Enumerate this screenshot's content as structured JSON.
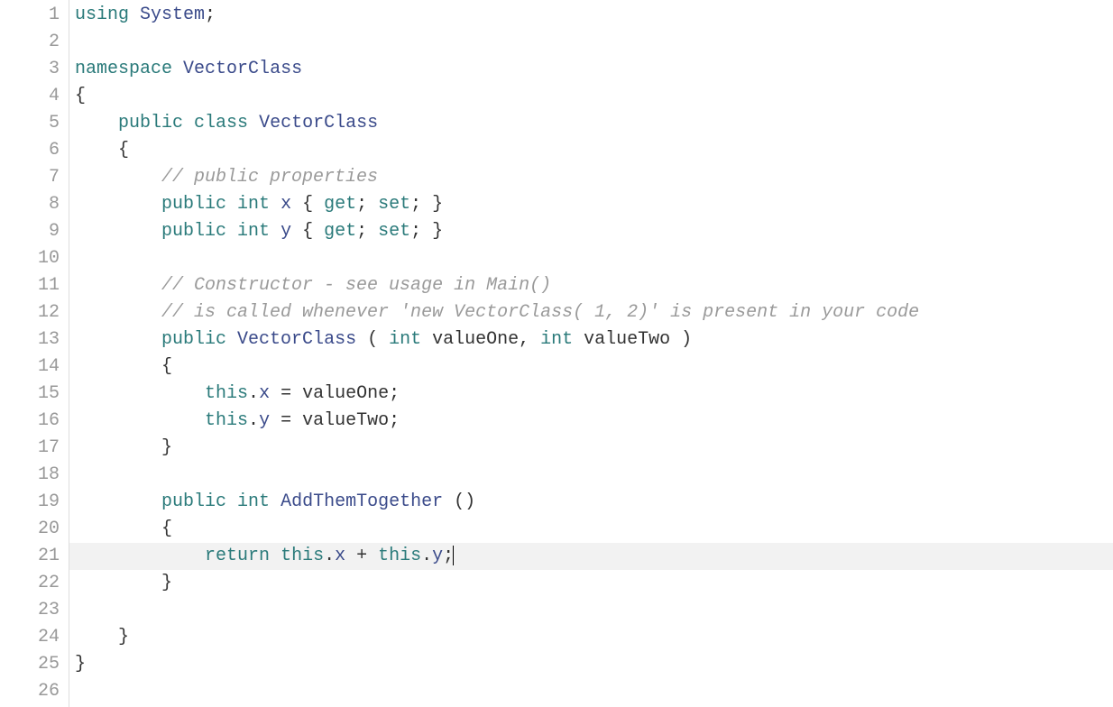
{
  "editor": {
    "total_lines": 26,
    "highlighted_line": 21,
    "caret_after_line": 21,
    "lines": [
      {
        "n": 1,
        "tokens": [
          [
            "kw",
            "using"
          ],
          [
            "pl",
            " "
          ],
          [
            "cls",
            "System"
          ],
          [
            "pl",
            ";"
          ]
        ]
      },
      {
        "n": 2,
        "tokens": []
      },
      {
        "n": 3,
        "tokens": [
          [
            "kw",
            "namespace"
          ],
          [
            "pl",
            " "
          ],
          [
            "cls",
            "VectorClass"
          ]
        ]
      },
      {
        "n": 4,
        "tokens": [
          [
            "pl",
            "{"
          ]
        ]
      },
      {
        "n": 5,
        "tokens": [
          [
            "pl",
            "    "
          ],
          [
            "kw",
            "public"
          ],
          [
            "pl",
            " "
          ],
          [
            "kw",
            "class"
          ],
          [
            "pl",
            " "
          ],
          [
            "cls",
            "VectorClass"
          ]
        ]
      },
      {
        "n": 6,
        "tokens": [
          [
            "pl",
            "    {"
          ]
        ]
      },
      {
        "n": 7,
        "tokens": [
          [
            "pl",
            "        "
          ],
          [
            "cm",
            "// public properties"
          ]
        ]
      },
      {
        "n": 8,
        "tokens": [
          [
            "pl",
            "        "
          ],
          [
            "kw",
            "public"
          ],
          [
            "pl",
            " "
          ],
          [
            "ty",
            "int"
          ],
          [
            "pl",
            " "
          ],
          [
            "mem",
            "x"
          ],
          [
            "pl",
            " { "
          ],
          [
            "kw",
            "get"
          ],
          [
            "pl",
            "; "
          ],
          [
            "kw",
            "set"
          ],
          [
            "pl",
            "; }"
          ]
        ]
      },
      {
        "n": 9,
        "tokens": [
          [
            "pl",
            "        "
          ],
          [
            "kw",
            "public"
          ],
          [
            "pl",
            " "
          ],
          [
            "ty",
            "int"
          ],
          [
            "pl",
            " "
          ],
          [
            "mem",
            "y"
          ],
          [
            "pl",
            " { "
          ],
          [
            "kw",
            "get"
          ],
          [
            "pl",
            "; "
          ],
          [
            "kw",
            "set"
          ],
          [
            "pl",
            "; }"
          ]
        ]
      },
      {
        "n": 10,
        "tokens": []
      },
      {
        "n": 11,
        "tokens": [
          [
            "pl",
            "        "
          ],
          [
            "cm",
            "// Constructor - see usage in Main()"
          ]
        ]
      },
      {
        "n": 12,
        "tokens": [
          [
            "pl",
            "        "
          ],
          [
            "cm",
            "// is called whenever 'new VectorClass( 1, 2)' is present in your code"
          ]
        ]
      },
      {
        "n": 13,
        "tokens": [
          [
            "pl",
            "        "
          ],
          [
            "kw",
            "public"
          ],
          [
            "pl",
            " "
          ],
          [
            "cls",
            "VectorClass"
          ],
          [
            "pl",
            " ( "
          ],
          [
            "ty",
            "int"
          ],
          [
            "pl",
            " valueOne, "
          ],
          [
            "ty",
            "int"
          ],
          [
            "pl",
            " valueTwo )"
          ]
        ]
      },
      {
        "n": 14,
        "tokens": [
          [
            "pl",
            "        {"
          ]
        ]
      },
      {
        "n": 15,
        "tokens": [
          [
            "pl",
            "            "
          ],
          [
            "kw",
            "this"
          ],
          [
            "pl",
            "."
          ],
          [
            "mem",
            "x"
          ],
          [
            "pl",
            " = valueOne;"
          ]
        ]
      },
      {
        "n": 16,
        "tokens": [
          [
            "pl",
            "            "
          ],
          [
            "kw",
            "this"
          ],
          [
            "pl",
            "."
          ],
          [
            "mem",
            "y"
          ],
          [
            "pl",
            " = valueTwo;"
          ]
        ]
      },
      {
        "n": 17,
        "tokens": [
          [
            "pl",
            "        }"
          ]
        ]
      },
      {
        "n": 18,
        "tokens": []
      },
      {
        "n": 19,
        "tokens": [
          [
            "pl",
            "        "
          ],
          [
            "kw",
            "public"
          ],
          [
            "pl",
            " "
          ],
          [
            "ty",
            "int"
          ],
          [
            "pl",
            " "
          ],
          [
            "cls",
            "AddThemTogether"
          ],
          [
            "pl",
            " ()"
          ]
        ]
      },
      {
        "n": 20,
        "tokens": [
          [
            "pl",
            "        {"
          ]
        ]
      },
      {
        "n": 21,
        "tokens": [
          [
            "pl",
            "            "
          ],
          [
            "kw",
            "return"
          ],
          [
            "pl",
            " "
          ],
          [
            "kw",
            "this"
          ],
          [
            "pl",
            "."
          ],
          [
            "mem",
            "x"
          ],
          [
            "pl",
            " + "
          ],
          [
            "kw",
            "this"
          ],
          [
            "pl",
            "."
          ],
          [
            "mem",
            "y"
          ],
          [
            "pl",
            ";"
          ]
        ]
      },
      {
        "n": 22,
        "tokens": [
          [
            "pl",
            "        }"
          ]
        ]
      },
      {
        "n": 23,
        "tokens": []
      },
      {
        "n": 24,
        "tokens": [
          [
            "pl",
            "    }"
          ]
        ]
      },
      {
        "n": 25,
        "tokens": [
          [
            "pl",
            "}"
          ]
        ]
      },
      {
        "n": 26,
        "tokens": []
      }
    ]
  }
}
